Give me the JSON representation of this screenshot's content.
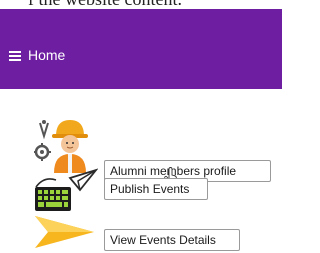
{
  "caption_fragment": "f the website content.",
  "appbar": {
    "title": "Home",
    "color": "#6e1ea1",
    "menu_icon": "hamburger-menu-icon"
  },
  "items": [
    {
      "label": "Alumni members profile",
      "icon": "engineer-avatar-icon"
    },
    {
      "label": "Publish Events",
      "icon": "keyboard-send-icon"
    },
    {
      "label": "View Events Details",
      "icon": "arrow-pointer-icon"
    }
  ],
  "pointer_icon": "hand-pointer-icon"
}
